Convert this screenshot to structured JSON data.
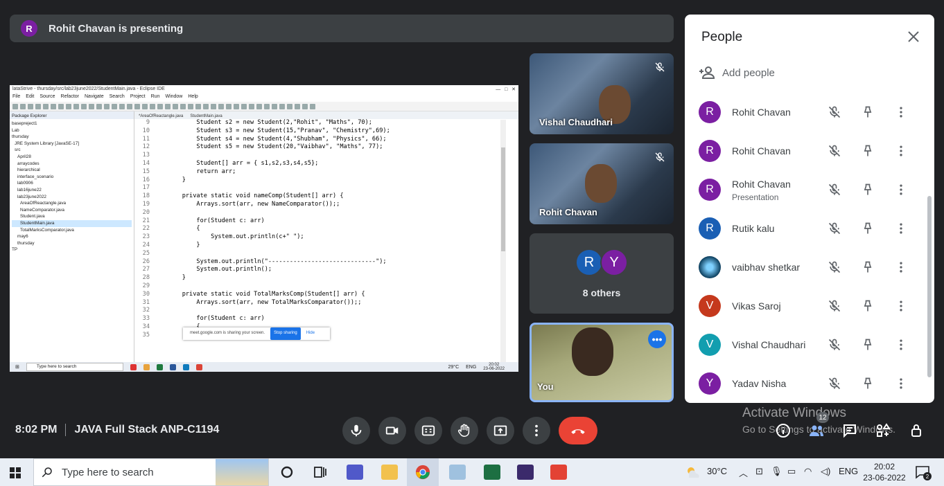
{
  "presenting": {
    "avatar": "R",
    "text": "Rohit Chavan is presenting",
    "avatar_color": "#7b1fa2"
  },
  "screen": {
    "title": "lataStrive - thursday/src/lab23june2022/StudentMain.java - Eclipse IDE",
    "menu": [
      "File",
      "Edit",
      "Source",
      "Refactor",
      "Navigate",
      "Search",
      "Project",
      "Run",
      "Window",
      "Help"
    ],
    "package_header": "Package Explorer",
    "packages": [
      "basepreject1",
      "Lab",
      "thursday",
      "JRE System Library [JavaSE-17]",
      "src",
      "April28",
      "arraycodes",
      "hierarchical",
      "interface_scenario",
      "lab0906",
      "lab16june22",
      "lab23june2022",
      "AreaOfReactangle.java",
      "NameComparator.java",
      "Student.java",
      "StudentMain.java",
      "TotalMarksComparator.java",
      "may6",
      "thursday",
      "TP"
    ],
    "editor_tabs": [
      "*AreaOfReactangle.java",
      "StudentMain.java"
    ],
    "code": [
      {
        "n": "9",
        "t": "        Student s2 = new Student(2,\"Rohit\", \"Maths\", 70);"
      },
      {
        "n": "10",
        "t": "        Student s3 = new Student(15,\"Pranav\", \"Chemistry\",69);"
      },
      {
        "n": "11",
        "t": "        Student s4 = new Student(4,\"Shubham\", \"Physics\", 66);"
      },
      {
        "n": "12",
        "t": "        Student s5 = new Student(20,\"Vaibhav\", \"Maths\", 77);"
      },
      {
        "n": "13",
        "t": ""
      },
      {
        "n": "14",
        "t": "        Student[] arr = { s1,s2,s3,s4,s5};"
      },
      {
        "n": "15",
        "t": "        return arr;"
      },
      {
        "n": "16",
        "t": "    }"
      },
      {
        "n": "17",
        "t": ""
      },
      {
        "n": "18",
        "t": "    private static void nameComp(Student[] arr) {"
      },
      {
        "n": "19",
        "t": "        Arrays.sort(arr, new NameComparator());;"
      },
      {
        "n": "20",
        "t": ""
      },
      {
        "n": "21",
        "t": "        for(Student c: arr)"
      },
      {
        "n": "22",
        "t": "        {"
      },
      {
        "n": "23",
        "t": "            System.out.println(c+\" \");"
      },
      {
        "n": "24",
        "t": "        }"
      },
      {
        "n": "25",
        "t": ""
      },
      {
        "n": "26",
        "t": "        System.out.println(\"------------------------------\");"
      },
      {
        "n": "27",
        "t": "        System.out.println();"
      },
      {
        "n": "28",
        "t": "    }"
      },
      {
        "n": "29",
        "t": ""
      },
      {
        "n": "30",
        "t": "    private static void TotalMarksComp(Student[] arr) {"
      },
      {
        "n": "31",
        "t": "        Arrays.sort(arr, new TotalMarksComparator());;"
      },
      {
        "n": "32",
        "t": ""
      },
      {
        "n": "33",
        "t": "        for(Student c: arr)"
      },
      {
        "n": "34",
        "t": "        {"
      },
      {
        "n": "35",
        "t": "            System.out.println(c+\" \");"
      }
    ],
    "share_popup": {
      "text": "meet.google.com is sharing your screen.",
      "stop": "Stop sharing",
      "hide": "Hide"
    },
    "inner_taskbar": {
      "search": "Type here to search",
      "temp": "29°C",
      "lang": "ENG",
      "time": "20:02",
      "date": "23-06-2022"
    }
  },
  "tiles": [
    {
      "name": "Vishal Chaudhari",
      "muted": true
    },
    {
      "name": "Rohit Chavan",
      "muted": true
    },
    {
      "others_label": "8 others",
      "avatars": [
        {
          "letter": "R",
          "color": "#1a5fb4"
        },
        {
          "letter": "Y",
          "color": "#7b1fa2"
        }
      ]
    },
    {
      "name": "You",
      "more": "•••"
    }
  ],
  "people_panel": {
    "title": "People",
    "add_people": "Add people",
    "participants": [
      {
        "avatar": "R",
        "name": "Rohit Chavan",
        "sub": "",
        "color": "#7b1fa2"
      },
      {
        "avatar": "R",
        "name": "Rohit Chavan",
        "sub": "",
        "color": "#7b1fa2"
      },
      {
        "avatar": "R",
        "name": "Rohit Chavan",
        "sub": "Presentation",
        "color": "#7b1fa2"
      },
      {
        "avatar": "R",
        "name": "Rutik kalu",
        "sub": "",
        "color": "#1a5fb4"
      },
      {
        "avatar": "",
        "name": "vaibhav shetkar",
        "sub": "",
        "color": "#0b3d5c"
      },
      {
        "avatar": "V",
        "name": "Vikas Saroj",
        "sub": "",
        "color": "#c5391d"
      },
      {
        "avatar": "V",
        "name": "Vishal Chaudhari",
        "sub": "",
        "color": "#129eaf"
      },
      {
        "avatar": "Y",
        "name": "Yadav Nisha",
        "sub": "",
        "color": "#7b1fa2"
      }
    ]
  },
  "bottom_bar": {
    "time": "8:02 PM",
    "meeting_name": "JAVA Full Stack ANP-C1194",
    "people_count": "12",
    "watermark_line1": "Activate Windows",
    "watermark_line2": "Go to Settings to activate Windows."
  },
  "taskbar": {
    "search_placeholder": "Type here to search",
    "temperature": "30°C",
    "language": "ENG",
    "time": "20:02",
    "date": "23-06-2022",
    "notifications": "2"
  }
}
